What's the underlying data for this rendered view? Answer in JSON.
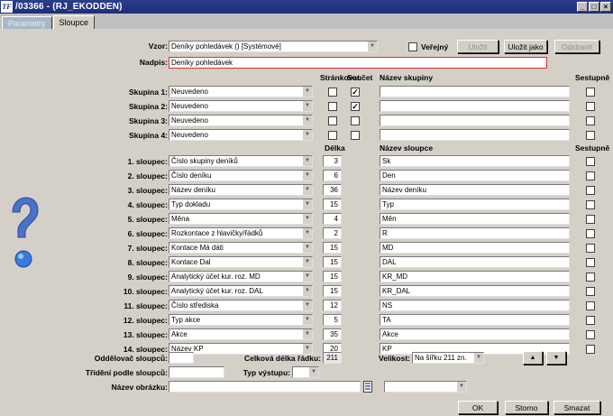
{
  "window": {
    "logo": "TF",
    "title": "/03366 - (RJ_EKODDEN)",
    "minimize": "_",
    "maximize": "□",
    "close": "×"
  },
  "tabs": [
    {
      "label": "Parametry",
      "active": false
    },
    {
      "label": "Sloupce",
      "active": true
    }
  ],
  "top": {
    "vzor_label": "Vzor:",
    "vzor_value": "Deníky pohledávek   ()   [Systémové]",
    "verejny_label": "Veřejný",
    "btn_ulozit": "Uložit",
    "btn_ulozit_jako": "Uložit jako",
    "btn_odstranit": "Odstranit",
    "nadpis_label": "Nadpis:",
    "nadpis_value": "Deníky pohledávek"
  },
  "group_headers": {
    "strankovat": "Stránkovat",
    "soucet": "Součet",
    "nazev_skupiny": "Název skupiny",
    "sestupne": "Sestupně"
  },
  "groups": [
    {
      "label": "Skupina 1:",
      "value": "Neuvedeno",
      "strankovat": false,
      "soucet": true,
      "name": "",
      "sestupne": false
    },
    {
      "label": "Skupina 2:",
      "value": "Neuvedeno",
      "strankovat": false,
      "soucet": true,
      "name": "",
      "sestupne": false
    },
    {
      "label": "Skupina 3:",
      "value": "Neuvedeno",
      "strankovat": false,
      "soucet": false,
      "name": "",
      "sestupne": false
    },
    {
      "label": "Skupina 4:",
      "value": "Neuvedeno",
      "strankovat": false,
      "soucet": false,
      "name": "",
      "sestupne": false
    }
  ],
  "column_headers": {
    "delka": "Délka",
    "nazev_sloupce": "Název sloupce",
    "sestupne": "Sestupně"
  },
  "columns": [
    {
      "label": "1. sloupec:",
      "value": "Číslo skupiny deníků",
      "delka": "3",
      "name": "Sk",
      "sestupne": false
    },
    {
      "label": "2. sloupec:",
      "value": "Číslo deníku",
      "delka": "6",
      "name": "Den",
      "sestupne": false
    },
    {
      "label": "3. sloupec:",
      "value": "Název deníku",
      "delka": "36",
      "name": "Název deníku",
      "sestupne": false
    },
    {
      "label": "4. sloupec:",
      "value": "Typ dokladu",
      "delka": "15",
      "name": "Typ",
      "sestupne": false
    },
    {
      "label": "5. sloupec:",
      "value": "Měna",
      "delka": "4",
      "name": "Měn",
      "sestupne": false
    },
    {
      "label": "6. sloupec:",
      "value": "Rozkontace z hlavičky/řádků",
      "delka": "2",
      "name": "R",
      "sestupne": false
    },
    {
      "label": "7. sloupec:",
      "value": "Kontace Má dáti",
      "delka": "15",
      "name": "MD",
      "sestupne": false
    },
    {
      "label": "8. sloupec:",
      "value": "Kontace Dal",
      "delka": "15",
      "name": "DAL",
      "sestupne": false
    },
    {
      "label": "9. sloupec:",
      "value": "Analytický účet kur. roz. MD",
      "delka": "15",
      "name": "KR_MD",
      "sestupne": false
    },
    {
      "label": "10. sloupec:",
      "value": "Analytický účet kur. roz. DAL",
      "delka": "15",
      "name": "KR_DAL",
      "sestupne": false
    },
    {
      "label": "11. sloupec:",
      "value": "Číslo střediska",
      "delka": "12",
      "name": "NS",
      "sestupne": false
    },
    {
      "label": "12. sloupec:",
      "value": "Typ akce",
      "delka": "5",
      "name": "TA",
      "sestupne": false
    },
    {
      "label": "13. sloupec:",
      "value": "Akce",
      "delka": "35",
      "name": "Akce",
      "sestupne": false
    },
    {
      "label": "14. sloupec:",
      "value": "Název KP",
      "delka": "20",
      "name": "KP",
      "sestupne": false
    }
  ],
  "bottom": {
    "oddelovac_label": "Oddělovač sloupců:",
    "oddelovac_value": "",
    "celkova_label": "Celková délka řádku:",
    "celkova_value": "211",
    "velikost_label": "Velikost:",
    "velikost_value": "Na šířku 211 zn.",
    "trideni_label": "Třídění podle sloupců:",
    "trideni_value": "",
    "typ_vystupu_label": "Typ výstupu:",
    "typ_vystupu_value": "",
    "nazev_obrazku_label": "Název obrázku:",
    "nazev_obrazku_value": "",
    "obrazek_combo_value": "",
    "up_arrow": "▲",
    "down_arrow": "▼",
    "btn_ok": "OK",
    "btn_storno": "Storno",
    "btn_smazat": "Smazat"
  },
  "colors": {
    "title_bar": "#1e2f78",
    "form_bg": "#d4d0c8",
    "required_border": "#e03030"
  }
}
